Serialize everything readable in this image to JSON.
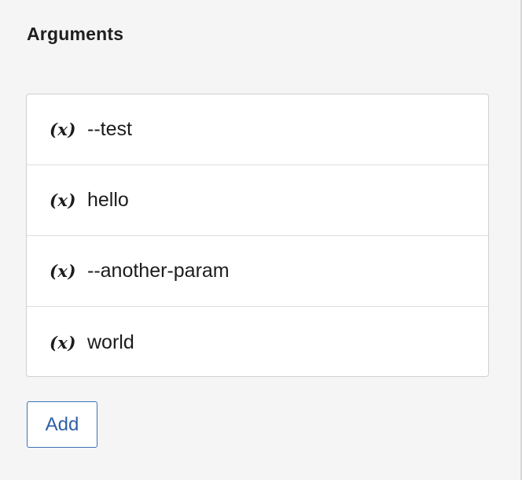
{
  "section": {
    "title": "Arguments"
  },
  "arguments": {
    "items": [
      {
        "icon": "variable-icon",
        "icon_glyph": "(x)",
        "label": "--test"
      },
      {
        "icon": "variable-icon",
        "icon_glyph": "(x)",
        "label": "hello"
      },
      {
        "icon": "variable-icon",
        "icon_glyph": "(x)",
        "label": "--another-param"
      },
      {
        "icon": "variable-icon",
        "icon_glyph": "(x)",
        "label": "world"
      }
    ]
  },
  "actions": {
    "add_label": "Add"
  },
  "colors": {
    "background": "#f5f5f5",
    "accent": "#2f5fa8",
    "border": "#d0d0d0"
  }
}
